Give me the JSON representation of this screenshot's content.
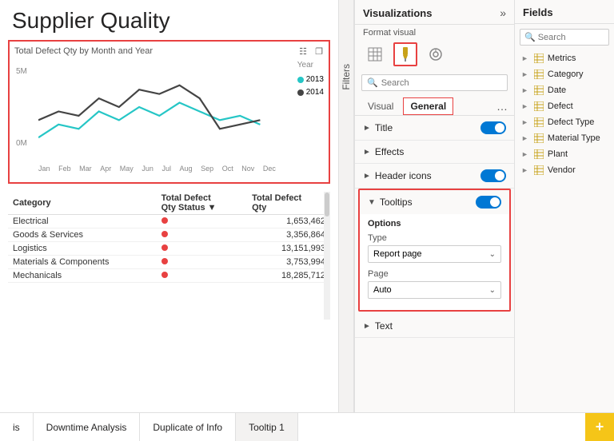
{
  "report": {
    "title": "Supplier Quality"
  },
  "chart": {
    "label": "Total Defect Qty by Month and Year",
    "y_labels": [
      "5M",
      "0M"
    ],
    "x_labels": [
      "Jan",
      "Feb",
      "Mar",
      "Apr",
      "May",
      "Jun",
      "Jul",
      "Aug",
      "Sep",
      "Oct",
      "Nov",
      "Dec"
    ],
    "legend": [
      {
        "year": "2013",
        "color": "#26c6c6"
      },
      {
        "year": "2014",
        "color": "#444444"
      }
    ]
  },
  "table": {
    "columns": [
      "Category",
      "Total Defect\nQty Status",
      "Total Defect\nQty"
    ],
    "rows": [
      {
        "category": "Electrical",
        "status_dot": true,
        "qty": "1,653,462"
      },
      {
        "category": "Goods & Services",
        "status_dot": true,
        "qty": "3,356,864"
      },
      {
        "category": "Logistics",
        "status_dot": true,
        "qty": "13,151,993"
      },
      {
        "category": "Materials & Components",
        "status_dot": true,
        "qty": "3,753,994"
      },
      {
        "category": "Mechanicals",
        "status_dot": true,
        "qty": "18,285,712"
      }
    ]
  },
  "visualizations": {
    "title": "Visualizations",
    "format_visual_label": "Format visual",
    "search_placeholder": "Search",
    "tabs": [
      {
        "label": "Visual",
        "active": false
      },
      {
        "label": "General",
        "active": true
      }
    ],
    "sections": [
      {
        "label": "Title",
        "toggle": true,
        "expanded": false
      },
      {
        "label": "Effects",
        "toggle": false,
        "expanded": false
      },
      {
        "label": "Header icons",
        "toggle": true,
        "expanded": false
      },
      {
        "label": "Tooltips",
        "toggle": true,
        "expanded": true,
        "highlighted": true,
        "subsections": {
          "options_label": "Options",
          "type_label": "Type",
          "type_value": "Report page",
          "page_label": "Page",
          "page_value": "Auto"
        }
      },
      {
        "label": "Text",
        "toggle": false,
        "expanded": false
      }
    ]
  },
  "fields": {
    "title": "Fields",
    "search_placeholder": "Search",
    "items": [
      {
        "label": "Metrics"
      },
      {
        "label": "Category"
      },
      {
        "label": "Date"
      },
      {
        "label": "Defect"
      },
      {
        "label": "Defect Type"
      },
      {
        "label": "Material Type"
      },
      {
        "label": "Plant"
      },
      {
        "label": "Vendor"
      }
    ]
  },
  "filters_label": "Filters",
  "bottom_tabs": [
    {
      "label": "is",
      "active": false
    },
    {
      "label": "Downtime Analysis",
      "active": false
    },
    {
      "label": "Duplicate of Info",
      "active": false
    },
    {
      "label": "Tooltip 1",
      "active": true
    }
  ],
  "add_tab_label": "+"
}
